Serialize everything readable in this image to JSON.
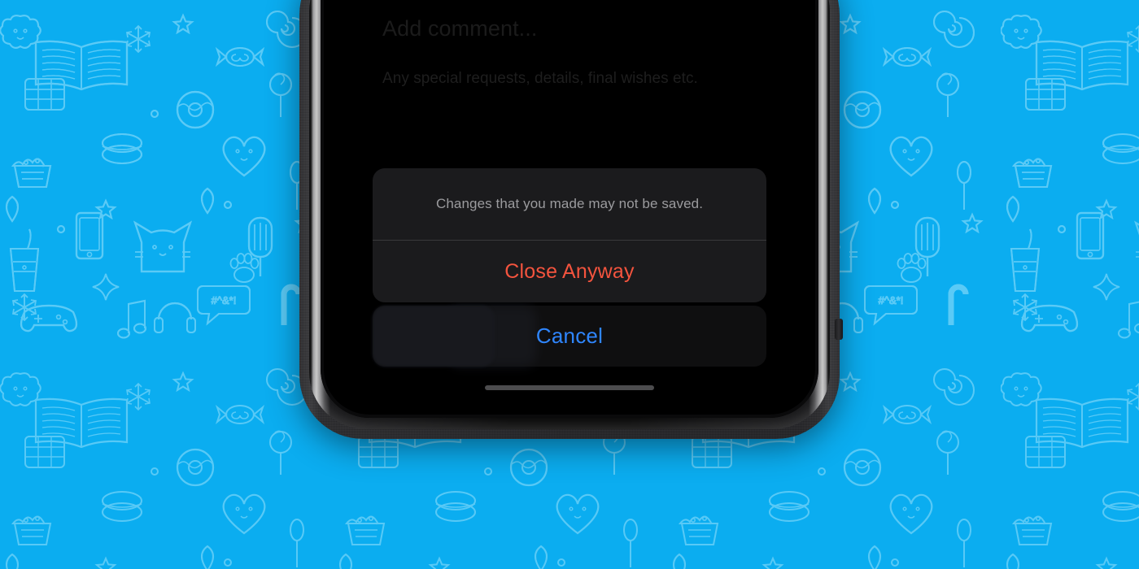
{
  "wallpaper": {
    "name": "telegram-doodle-pattern",
    "base_color": "#0BADF0",
    "doodle_color": "#5CCBF7"
  },
  "device": {
    "name": "iphone-frame",
    "frame_color": "#2a2a2d",
    "rim_color": "#c8c8c8",
    "bezel_color": "#000000"
  },
  "screen": {
    "background": "#000000",
    "form": {
      "title": "Add comment...",
      "subtitle": "Any special requests, details, final wishes etc."
    },
    "action_sheet": {
      "message": "Changes that you made may not be saved.",
      "destructive_label": "Close Anyway",
      "cancel_label": "Cancel",
      "destructive_color": "#F4543E",
      "cancel_color": "#2F86FF",
      "message_color": "#9B9B9E",
      "group_background": "#1B1B1D"
    },
    "home_indicator": {
      "color": "#4C4C4E"
    }
  }
}
